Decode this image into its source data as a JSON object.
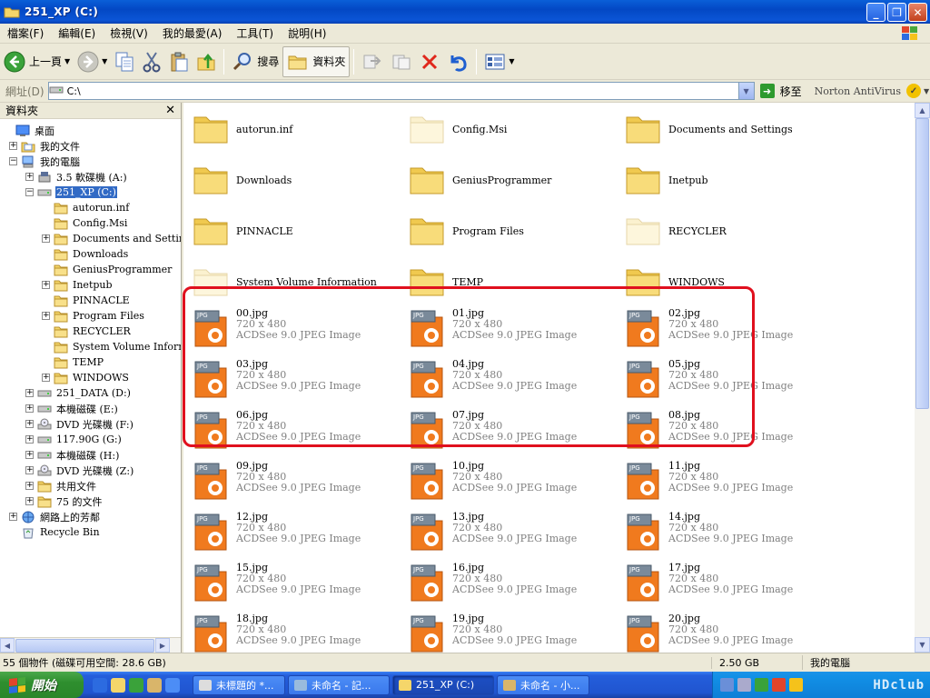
{
  "window": {
    "title": "251_XP (C:)"
  },
  "menu": [
    "檔案(F)",
    "編輯(E)",
    "檢視(V)",
    "我的最愛(A)",
    "工具(T)",
    "說明(H)"
  ],
  "toolbar": {
    "back_label": "上一頁",
    "search_label": "搜尋",
    "folders_label": "資料夾"
  },
  "address": {
    "label": "網址(D)",
    "value": "C:\\",
    "go_label": "移至",
    "norton_label": "Norton AntiVirus"
  },
  "folder_pane": {
    "title": "資料夾",
    "tree": [
      {
        "label": "桌面"
      },
      {
        "label": "我的文件",
        "expander": "+"
      },
      {
        "label": "我的電腦",
        "expander": "−"
      },
      {
        "label": "3.5 軟碟機 (A:)",
        "expander": "+"
      },
      {
        "label": "251_XP (C:)",
        "expander": "−"
      },
      {
        "label": "autorun.inf"
      },
      {
        "label": "Config.Msi"
      },
      {
        "label": "Documents and Settings",
        "expander": "+"
      },
      {
        "label": "Downloads"
      },
      {
        "label": "GeniusProgrammer"
      },
      {
        "label": "Inetpub",
        "expander": "+"
      },
      {
        "label": "PINNACLE"
      },
      {
        "label": "Program Files",
        "expander": "+"
      },
      {
        "label": "RECYCLER"
      },
      {
        "label": "System Volume Informati"
      },
      {
        "label": "TEMP"
      },
      {
        "label": "WINDOWS",
        "expander": "+"
      },
      {
        "label": "251_DATA (D:)",
        "expander": "+"
      },
      {
        "label": "本機磁碟 (E:)",
        "expander": "+"
      },
      {
        "label": "DVD 光碟機 (F:)",
        "expander": "+"
      },
      {
        "label": "117.90G (G:)",
        "expander": "+"
      },
      {
        "label": "本機磁碟 (H:)",
        "expander": "+"
      },
      {
        "label": "DVD 光碟機 (Z:)",
        "expander": "+"
      },
      {
        "label": "共用文件",
        "expander": "+"
      },
      {
        "label": "75 的文件",
        "expander": "+"
      },
      {
        "label": "網路上的芳鄰",
        "expander": "+"
      },
      {
        "label": "Recycle Bin"
      }
    ]
  },
  "files": {
    "folders": [
      "autorun.inf",
      "Config.Msi",
      "Documents and Settings",
      "Downloads",
      "GeniusProgrammer",
      "Inetpub",
      "PINNACLE",
      "Program Files",
      "RECYCLER",
      "System Volume Information",
      "TEMP",
      "WINDOWS"
    ],
    "images": [
      {
        "name": "00.jpg"
      },
      {
        "name": "01.jpg"
      },
      {
        "name": "02.jpg"
      },
      {
        "name": "03.jpg"
      },
      {
        "name": "04.jpg"
      },
      {
        "name": "05.jpg"
      },
      {
        "name": "06.jpg"
      },
      {
        "name": "07.jpg"
      },
      {
        "name": "08.jpg"
      },
      {
        "name": "09.jpg"
      },
      {
        "name": "10.jpg"
      },
      {
        "name": "11.jpg"
      },
      {
        "name": "12.jpg"
      },
      {
        "name": "13.jpg"
      },
      {
        "name": "14.jpg"
      },
      {
        "name": "15.jpg"
      },
      {
        "name": "16.jpg"
      },
      {
        "name": "17.jpg"
      },
      {
        "name": "18.jpg"
      },
      {
        "name": "19.jpg"
      },
      {
        "name": "20.jpg"
      }
    ],
    "image_dims": "720 x 480",
    "image_type": "ACDSee 9.0 JPEG Image",
    "badge": "JPG"
  },
  "status": {
    "left": "55 個物件 (磁碟可用空間: 28.6 GB)",
    "size": "2.50 GB",
    "location": "我的電腦"
  },
  "taskbar": {
    "start_label": "開始",
    "tasks": [
      "未標題的 *...",
      "未命名 - 記...",
      "251_XP (C:)",
      "未命名 - 小..."
    ],
    "clock_text": "HDclub"
  }
}
